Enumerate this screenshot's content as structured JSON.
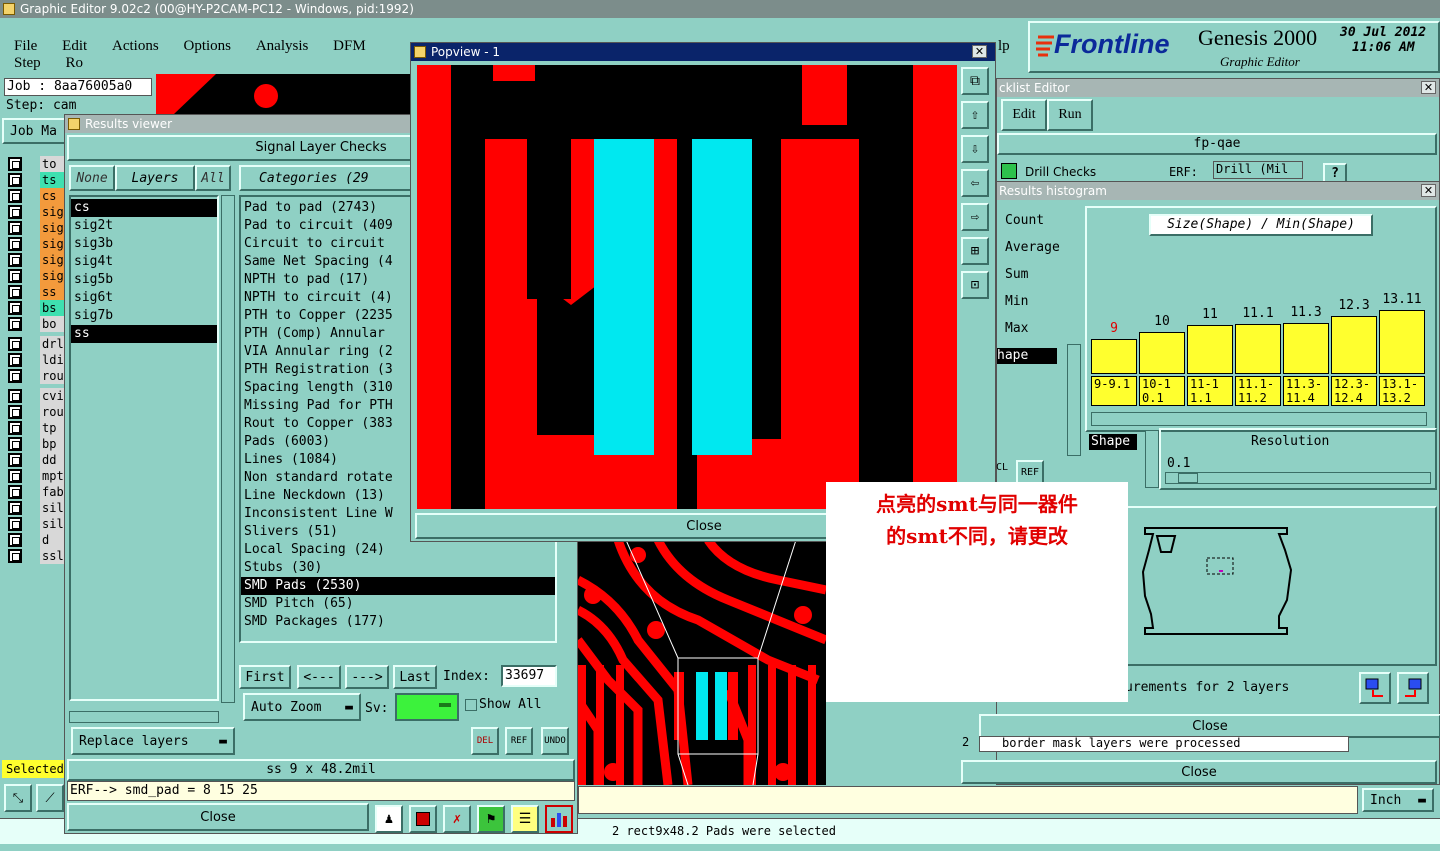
{
  "main": {
    "title": "Graphic Editor 9.02c2 (00@HY-P2CAM-PC12 - Windows, pid:1992)",
    "menu": [
      "File",
      "Edit",
      "Actions",
      "Options",
      "Analysis",
      "DFM",
      "Step",
      "Ro",
      "lp"
    ],
    "job": "Job : 8aa76005a0",
    "step": "Step: cam",
    "job_tab": "Job Ma",
    "selected": "Selected",
    "unit": "Inch",
    "status": "2 rect9x48.2 Pads were selected"
  },
  "brand": {
    "logo": "Frontline",
    "product": "Genesis 2000",
    "date": "30 Jul 2012",
    "time": "11:06 AM",
    "subtitle": "Graphic Editor"
  },
  "layers": [
    {
      "name": "to",
      "color": "#d8d8d8"
    },
    {
      "name": "ts",
      "color": "#3ee0b0"
    },
    {
      "name": "cs",
      "color": "#f39a3c"
    },
    {
      "name": "sig",
      "color": "#f39a3c"
    },
    {
      "name": "sig",
      "color": "#f39a3c"
    },
    {
      "name": "sig",
      "color": "#f39a3c"
    },
    {
      "name": "sig",
      "color": "#f39a3c"
    },
    {
      "name": "sig",
      "color": "#f39a3c"
    },
    {
      "name": "ss",
      "color": "#f39a3c"
    },
    {
      "name": "bs",
      "color": "#3ee0b0"
    },
    {
      "name": "bo",
      "color": "#d8d8d8"
    },
    {
      "name": "drl",
      "color": "#d8d8d8"
    },
    {
      "name": "ldi",
      "color": "#d8d8d8"
    },
    {
      "name": "rou",
      "color": "#d8d8d8"
    },
    {
      "name": "cvi",
      "color": "#d8d8d8"
    },
    {
      "name": "rou",
      "color": "#d8d8d8"
    },
    {
      "name": "tp",
      "color": "#d8d8d8"
    },
    {
      "name": "bp",
      "color": "#d8d8d8"
    },
    {
      "name": "dd",
      "color": "#d8d8d8"
    },
    {
      "name": "mpt",
      "color": "#d8d8d8"
    },
    {
      "name": "fab",
      "color": "#d8d8d8"
    },
    {
      "name": "sil",
      "color": "#d8d8d8"
    },
    {
      "name": "sil",
      "color": "#d8d8d8"
    },
    {
      "name": "d",
      "color": "#d8d8d8"
    },
    {
      "name": "ssl",
      "color": "#d8d8d8"
    }
  ],
  "results": {
    "title": "Results viewer",
    "header": "Signal Layer Checks",
    "none": "None",
    "layers_label": "Layers",
    "all": "All",
    "categories_label": "Categories (29",
    "layers": [
      "cs",
      "sig2t",
      "sig3b",
      "sig4t",
      "sig5b",
      "sig6t",
      "sig7b",
      "ss"
    ],
    "categories": [
      "Pad to pad (2743)",
      "Pad to circuit (409",
      "Circuit to circuit",
      "Same Net Spacing (4",
      "NPTH to pad (17)",
      "NPTH to circuit (4)",
      "PTH to Copper (2235",
      "PTH (Comp) Annular",
      "VIA Annular ring (2",
      "PTH Registration (3",
      "Spacing length (310",
      "Missing Pad for PTH",
      "Rout to Copper (383",
      "Pads (6003)",
      "Lines (1084)",
      "Non standard rotate",
      "Line Neckdown (13)",
      "Inconsistent Line W",
      "Slivers (51)",
      "Local Spacing (24)",
      "Stubs (30)",
      "SMD Pads (2530)",
      "SMD Pitch (65)",
      "SMD Packages (177)"
    ],
    "first": "First",
    "prev": "<---",
    "next": "--->",
    "last": "Last",
    "index_label": "Index:",
    "index": "33697",
    "auto_zoom": "Auto Zoom",
    "sv": "Sv:",
    "show_all": "Show All",
    "replace": "Replace layers",
    "del": "DEL",
    "ref": "REF",
    "undo": "UNDO",
    "info": "ss 9 x 48.2mil",
    "erf": "ERF--> smd_pad = 8 15 25",
    "close": "Close"
  },
  "popview": {
    "title": "Popview - 1",
    "close": "Close"
  },
  "checklist": {
    "title": "cklist Editor",
    "edit": "Edit",
    "run": "Run",
    "name": "fp-qae",
    "row": "Drill Checks",
    "erf": "ERF:",
    "drill": "Drill (Mil",
    "q": "?"
  },
  "histogram": {
    "title": "Results histogram",
    "stats": [
      "Count",
      "Average",
      "Sum",
      "Min",
      "Max"
    ],
    "selected": "hape",
    "header": "Size(Shape) / Min(Shape)",
    "bars": [
      {
        "label": "9",
        "value": 9,
        "range": "9-9.1",
        "red": true
      },
      {
        "label": "10",
        "value": 10,
        "range": "10-10.1",
        "red": false
      },
      {
        "label": "11",
        "value": 11,
        "range": "11-11.1",
        "red": false
      },
      {
        "label": "11.1",
        "value": 11.1,
        "range": "11.1-11.2",
        "red": false
      },
      {
        "label": "11.3",
        "value": 11.3,
        "range": "11.3-11.4",
        "red": false
      },
      {
        "label": "12.3",
        "value": 12.3,
        "range": "12.3-12.4",
        "red": false
      },
      {
        "label": "13.11",
        "value": 13.11,
        "range": "13.1-13.2",
        "red": false
      }
    ],
    "shape": "Shape",
    "resolution": "Resolution",
    "res_value": "0.1",
    "measurements": "urements for 2 layers",
    "close": "Close",
    "cl": "CL",
    "ref": "REF"
  },
  "bottom": {
    "msg": "border mask layers were processed",
    "close": "Close",
    "num": "2"
  },
  "annotation": {
    "line1": "点亮的smt与同一器件",
    "line2": "的smt不同，请更改"
  }
}
